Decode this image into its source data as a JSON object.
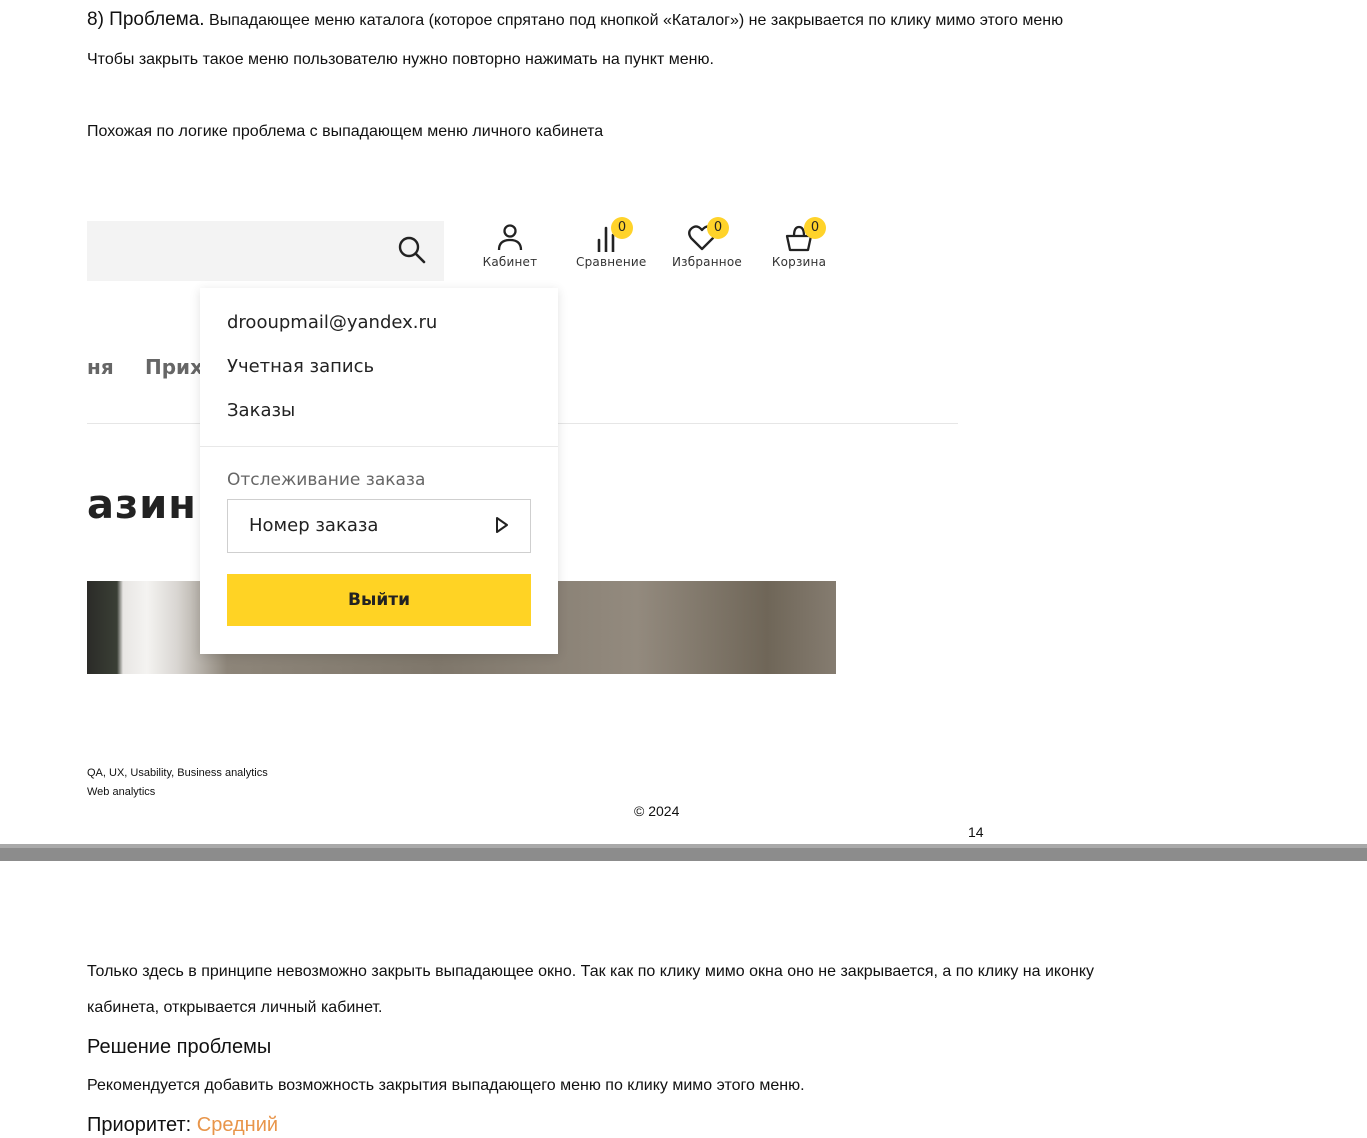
{
  "page14": {
    "problem_prefix": "8) Проблема.",
    "problem_text": "Выпадающее меню каталога (которое спрятано под кнопкой «Каталог») не закрывается по клику мимо этого меню",
    "line2": "Чтобы закрыть такое меню пользователю нужно повторно нажимать на пункт меню.",
    "line3": "Похожая по логике проблема с выпадающем меню личного кабинета",
    "footer_line1": "QA, UX, Usability, Business analytics",
    "footer_line2": "Web analytics",
    "copyright": "© 2024",
    "page_number": "14"
  },
  "screenshot": {
    "header_icons": [
      {
        "label": "Кабинет",
        "icon": "user-icon"
      },
      {
        "label": "Сравнение",
        "icon": "bar-chart-icon",
        "badge": "0"
      },
      {
        "label": "Избранное",
        "icon": "heart-icon",
        "badge": "0"
      },
      {
        "label": "Корзина",
        "icon": "basket-icon",
        "badge": "0"
      }
    ],
    "nav_partial_left": "ня",
    "nav_partial_right": "Прих",
    "heading_partial": "азин",
    "dropdown": {
      "email": "drooupmail@yandex.ru",
      "account": "Учетная запись",
      "orders": "Заказы",
      "tracking_label": "Отслеживание заказа",
      "order_placeholder": "Номер заказа",
      "logout": "Выйти"
    },
    "accent_color": "#ffd324"
  },
  "page15": {
    "para1_line1": "Только здесь в принципе невозможно закрыть выпадающее окно. Так как по клику мимо окна оно не закрывается, а по клику на иконку",
    "para1_line2": "кабинета, открывается личный кабинет.",
    "solution_heading": "Решение проблемы",
    "solution_text": "Рекомендуется добавить возможность закрытия выпадающего меню по клику мимо этого меню.",
    "priority_label": "Приоритет:",
    "priority_value": "Средний",
    "priority_color": "#e8954a"
  }
}
